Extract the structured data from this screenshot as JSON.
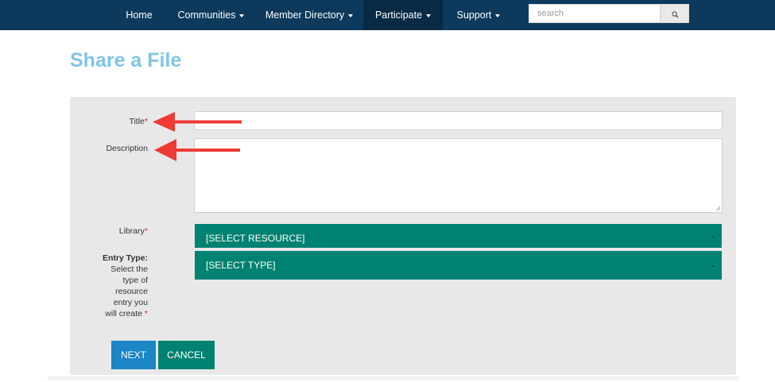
{
  "nav": {
    "items": [
      {
        "label": "Home",
        "dropdown": false
      },
      {
        "label": "Communities",
        "dropdown": true
      },
      {
        "label": "Member Directory",
        "dropdown": true
      },
      {
        "label": "Participate",
        "dropdown": true,
        "active": true
      },
      {
        "label": "Support",
        "dropdown": true
      }
    ],
    "search_placeholder": "search"
  },
  "page": {
    "title": "Share a File"
  },
  "form": {
    "title_label": "Title",
    "description_label": "Description",
    "library_label": "Library",
    "library_value": "[SELECT RESOURCE]",
    "entry_type_label": "Entry Type:",
    "entry_type_help": [
      "Select the",
      "type of",
      "resource",
      "entry you",
      "will create"
    ],
    "entry_type_value": "[SELECT TYPE]",
    "required_marker": "*"
  },
  "buttons": {
    "next": "NEXT",
    "cancel": "CANCEL"
  },
  "colors": {
    "nav_bg": "#0d3a5c",
    "nav_active": "#082a44",
    "title": "#7fc5e6",
    "teal": "#008272",
    "next_blue": "#1b85c6",
    "arrow_red": "#ee3b36"
  }
}
